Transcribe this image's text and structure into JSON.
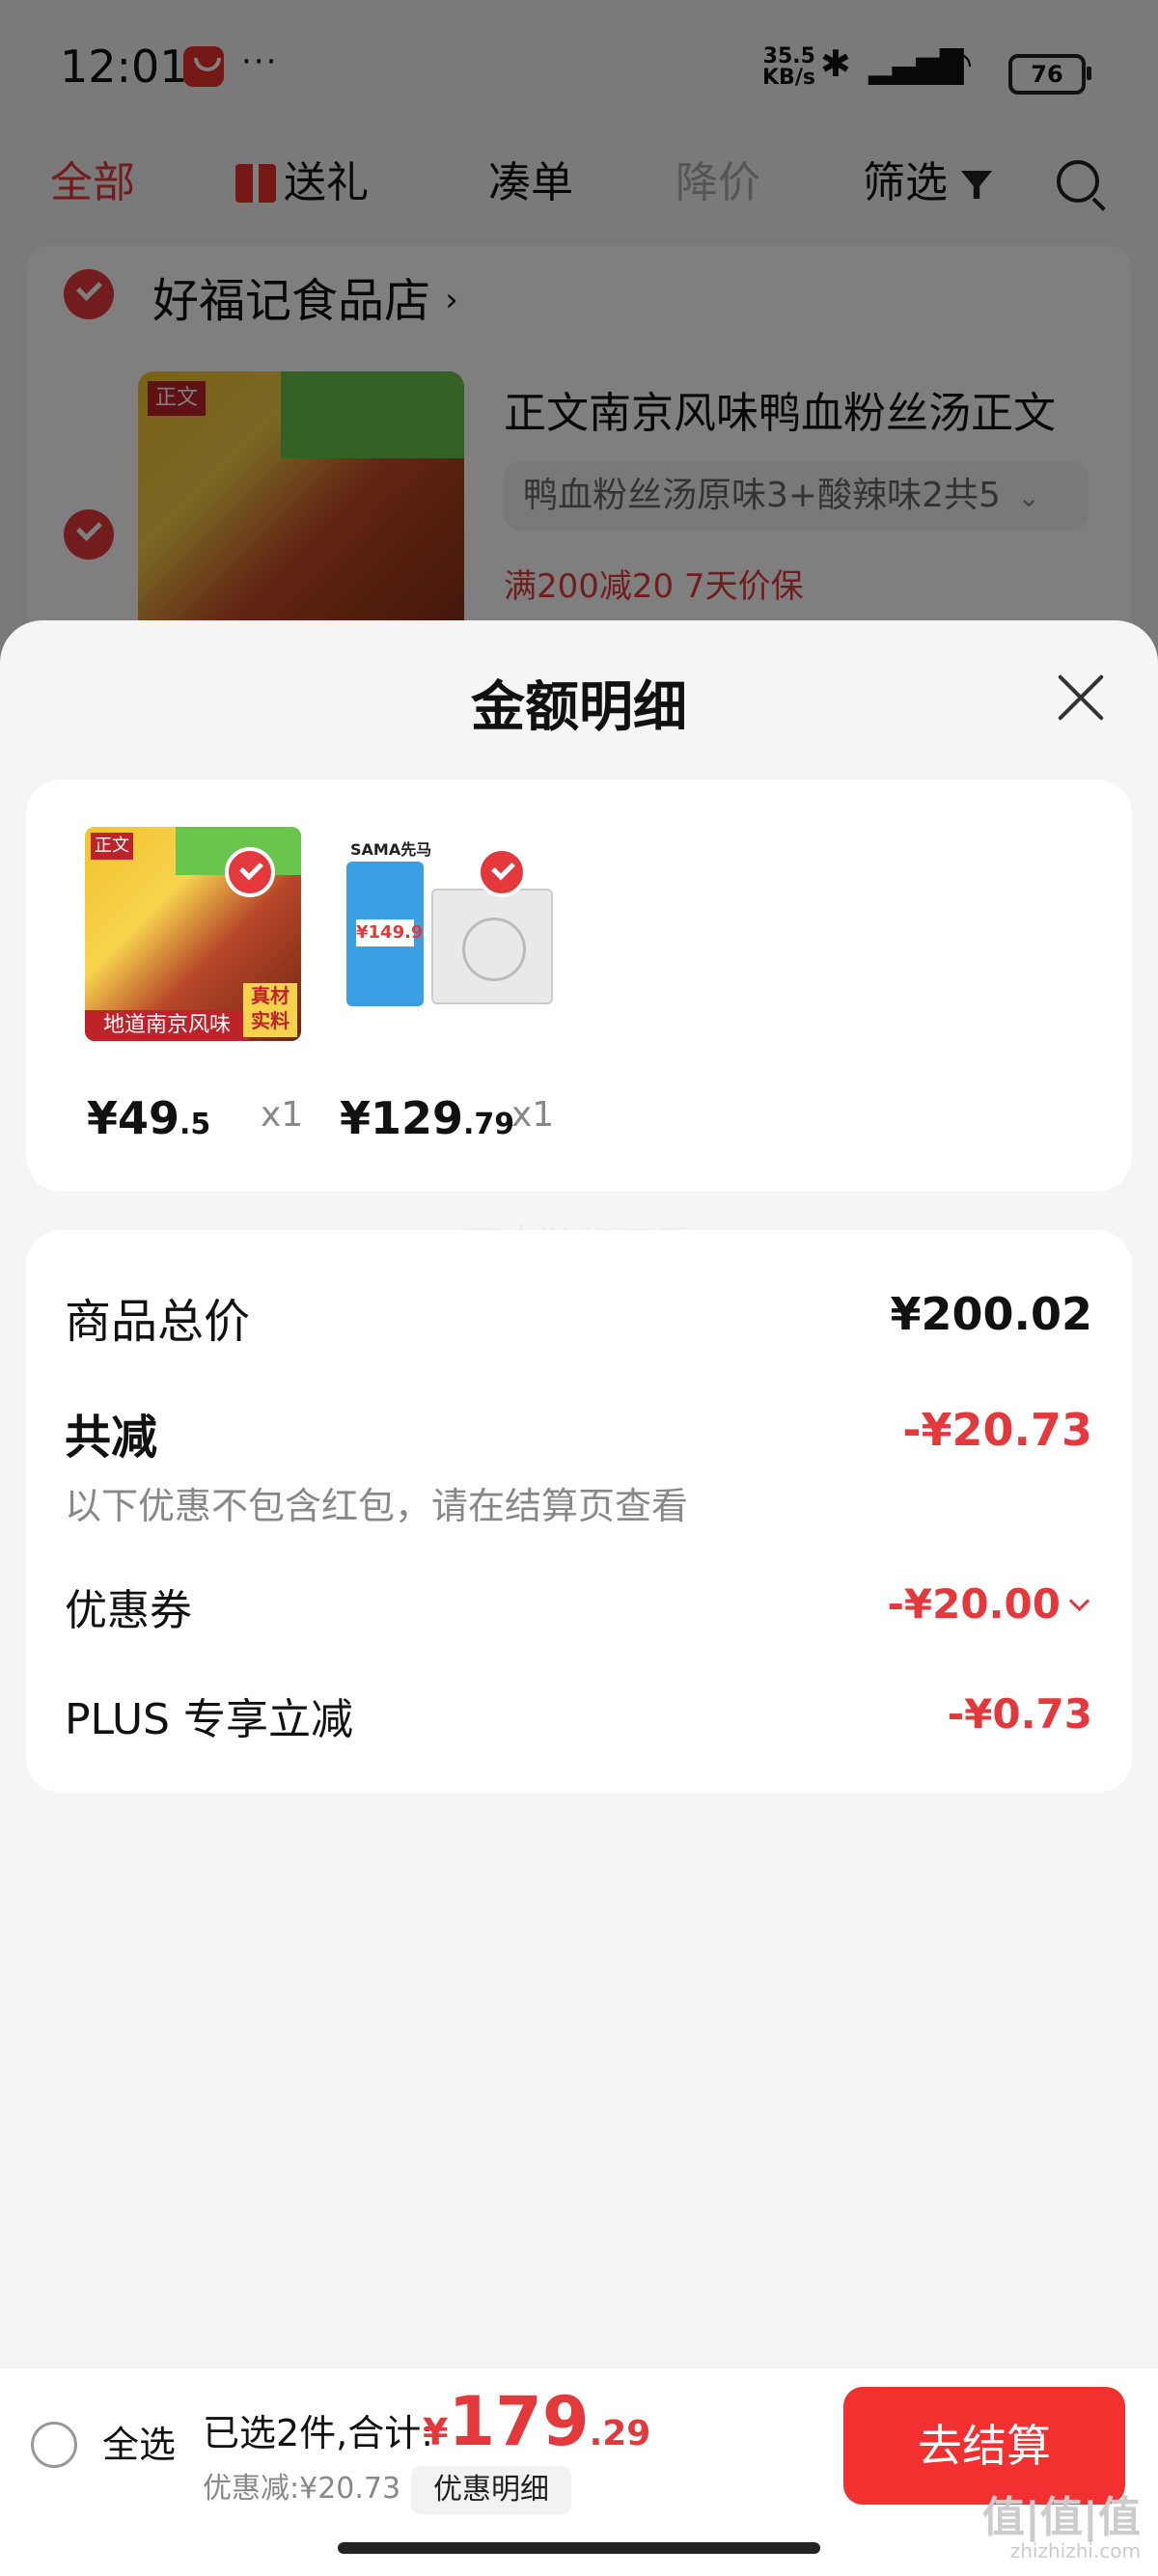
{
  "status": {
    "time": "12:01",
    "dots": "···",
    "net_speed": "35.5",
    "net_unit": "KB/s",
    "battery": "76"
  },
  "tabs": [
    {
      "label": "全部"
    },
    {
      "label": "送礼"
    },
    {
      "label": "凑单"
    },
    {
      "label": "降价"
    },
    {
      "label": "筛选"
    }
  ],
  "store": {
    "name": "好福记食品店",
    "arrow": "›"
  },
  "cart_item": {
    "name": "正文南京风味鸭血粉丝汤正文",
    "spec": "鸭血粉丝汤原味3+酸辣味2共5",
    "spec_arrow": "⌄",
    "tags": "满200减20  7天价保",
    "img_brand": "正文"
  },
  "sheet": {
    "title": "金额明细",
    "products": [
      {
        "price_int": "¥49",
        "price_dec": ".5",
        "qty": "x1",
        "img_brand": "正文",
        "img_caption": "地道南京风味",
        "img_badge": "真材实料"
      },
      {
        "price_int": "¥129",
        "price_dec": ".79",
        "qty": "x1",
        "img_brand": "SAMA先马",
        "img_price": "¥149.9"
      }
    ],
    "watermark": "萧太狼好可爱",
    "summary": {
      "total_label": "商品总价",
      "total_value": "¥200.02",
      "reduce_label": "共减",
      "reduce_value": "-¥20.73",
      "note": "以下优惠不包含红包，请在结算页查看",
      "coupon_label": "优惠券",
      "coupon_value": "-¥20.00",
      "plus_label": "PLUS 专享立减",
      "plus_value": "-¥0.73"
    }
  },
  "bottom_bar": {
    "select_all": "全选",
    "selected_text": "已选2件,合计:",
    "total_currency": "¥",
    "total_int": "179",
    "total_dec": ".29",
    "discount_text": "优惠减:¥20.73",
    "detail_button": "优惠明细",
    "checkout_button": "去结算"
  },
  "site_watermark": {
    "main": "值|值|值",
    "sub": "zhizhizhi.com"
  },
  "colors": {
    "accent": "#e4393c",
    "checkout": "#f23030"
  }
}
